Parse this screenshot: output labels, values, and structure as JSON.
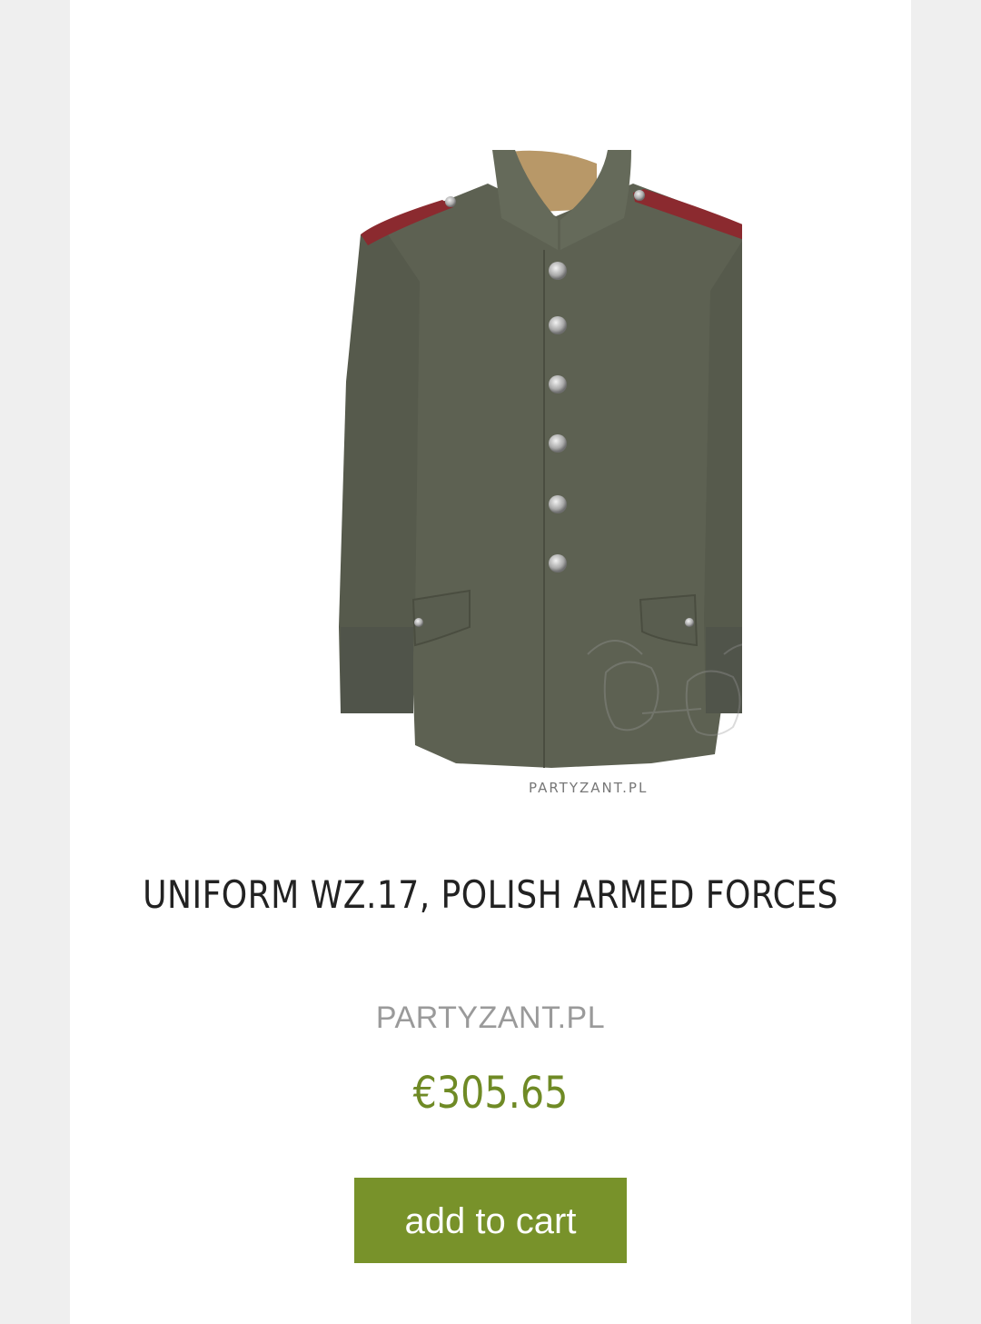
{
  "product": {
    "title": "UNIFORM WZ.17, POLISH ARMED FORCES",
    "brand": "PARTYZANT.PL",
    "price": "€305.65",
    "image_watermark": "PARTYZANT.PL",
    "add_to_cart_label": "add to cart"
  },
  "colors": {
    "accent": "#78922a",
    "price": "#6f8a25",
    "jacket": "#5d6152",
    "epaulette_piping": "#8b2a2f"
  }
}
